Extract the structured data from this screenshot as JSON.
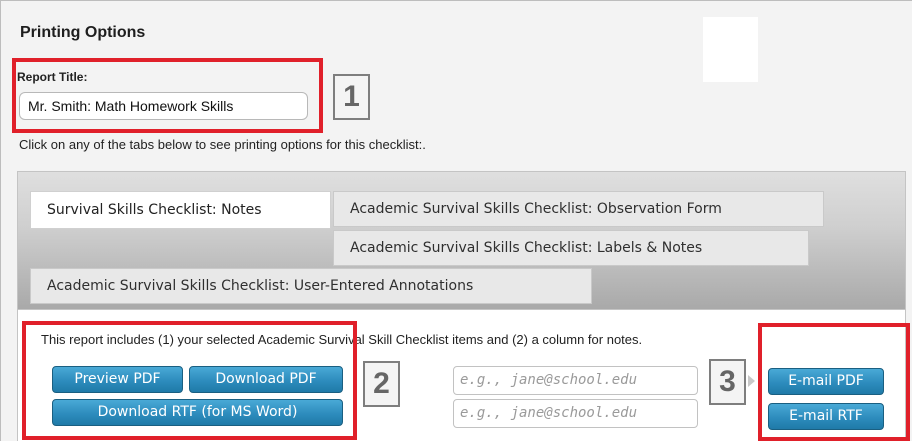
{
  "header": {
    "title": "Printing Options"
  },
  "report": {
    "label": "Report Title:",
    "value": "Mr. Smith: Math Homework Skills"
  },
  "instructions": "Click on any of the tabs below to see printing options for this checklist:.",
  "tabs": [
    {
      "label": "Survival Skills Checklist: Notes",
      "active": true
    },
    {
      "label": "Academic Survival Skills Checklist: Observation Form",
      "active": false
    },
    {
      "label": "Academic Survival Skills Checklist: Labels & Notes",
      "active": false
    },
    {
      "label": "Academic Survival Skills Checklist: User-Entered Annotations",
      "active": false
    }
  ],
  "panel": {
    "description": "This report includes (1) your selected Academic Survival Skill Checklist items and (2) a column for notes.",
    "buttons": {
      "preview_pdf": "Preview PDF",
      "download_pdf": "Download PDF",
      "download_rtf": "Download RTF (for MS Word)",
      "email_pdf": "E-mail PDF",
      "email_rtf": "E-mail RTF"
    },
    "email_placeholder_1": "e.g., jane@school.edu",
    "email_placeholder_2": "e.g., jane@school.edu"
  },
  "callouts": {
    "one": "1",
    "two": "2",
    "three": "3"
  },
  "colors": {
    "highlight_red": "#e0202a",
    "button_blue": "#2d8cbd",
    "tab_bar_gray": "#cfcfcf"
  }
}
